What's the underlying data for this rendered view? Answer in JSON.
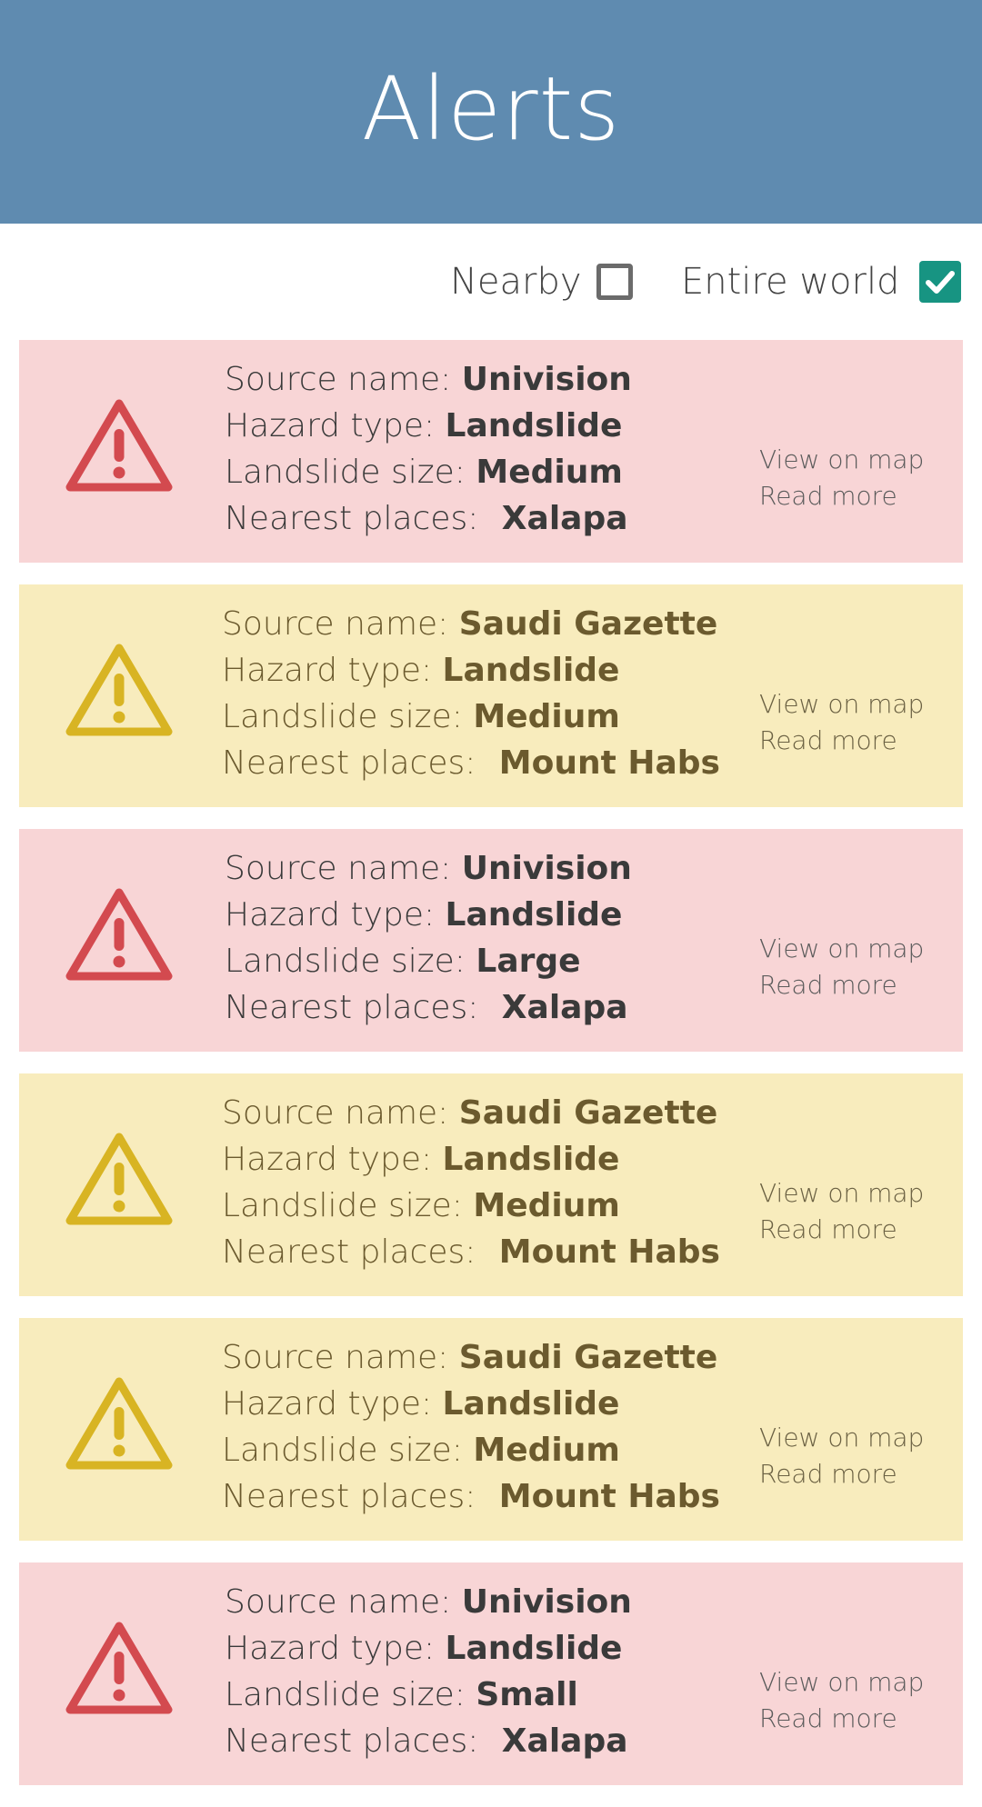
{
  "header": {
    "title": "Alerts"
  },
  "filters": {
    "nearby": {
      "label": "Nearby",
      "checked": false
    },
    "world": {
      "label": "Entire world",
      "checked": true
    }
  },
  "labels": {
    "source": "Source name: ",
    "hazard": "Hazard type: ",
    "size": "Landslide size: ",
    "places": "Nearest places: ",
    "view_on_map": "View on map",
    "read_more": "Read more"
  },
  "colors": {
    "header": "#5f8bb0",
    "red_card": "#f8d5d6",
    "yellow_card": "#f8ecbd",
    "red_icon": "#d34a4f",
    "yellow_icon": "#d8b423",
    "checkbox_checked": "#179482"
  },
  "alerts": [
    {
      "severity": "red",
      "icon": "warning-triangle-icon",
      "source": "Univision",
      "hazard": "Landslide",
      "size": "Medium",
      "places": "Xalapa"
    },
    {
      "severity": "yellow",
      "icon": "warning-triangle-icon",
      "source": "Saudi Gazette",
      "hazard": "Landslide",
      "size": "Medium",
      "places": "Mount Habs"
    },
    {
      "severity": "red",
      "icon": "warning-triangle-icon",
      "source": "Univision",
      "hazard": "Landslide",
      "size": "Large",
      "places": "Xalapa"
    },
    {
      "severity": "yellow",
      "icon": "warning-triangle-icon",
      "source": "Saudi Gazette",
      "hazard": "Landslide",
      "size": "Medium",
      "places": "Mount Habs"
    },
    {
      "severity": "yellow",
      "icon": "warning-triangle-icon",
      "source": "Saudi Gazette",
      "hazard": "Landslide",
      "size": "Medium",
      "places": "Mount Habs"
    },
    {
      "severity": "red",
      "icon": "warning-triangle-icon",
      "source": "Univision",
      "hazard": "Landslide",
      "size": "Small",
      "places": "Xalapa"
    }
  ]
}
